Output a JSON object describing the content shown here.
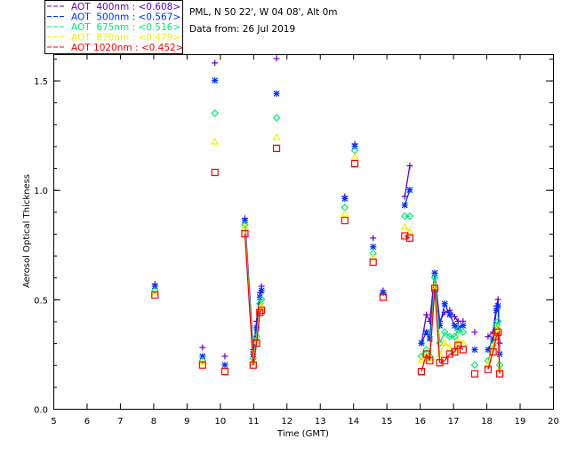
{
  "chart_data": {
    "type": "scatter",
    "title_lines": [
      "PML, N 50 22', W 04 08', Alt 0m",
      "Data from: 26 Jul 2019"
    ],
    "xlabel": "Time (GMT)",
    "ylabel": "Aerosol Optical Thickness",
    "xlim": [
      5,
      20
    ],
    "ylim": [
      0,
      1.62
    ],
    "xticks": [
      "5",
      "6",
      "7",
      "8",
      "9",
      "10",
      "11",
      "12",
      "13",
      "14",
      "15",
      "16",
      "17",
      "18",
      "19",
      "20"
    ],
    "yticks": [
      "0.0",
      "0.5",
      "1.0",
      "1.5"
    ],
    "legend_placement": "top-left",
    "x": [
      8.05,
      9.48,
      9.85,
      10.15,
      10.75,
      11.0,
      11.1,
      11.2,
      11.25,
      11.7,
      13.75,
      14.05,
      14.6,
      14.9,
      15.55,
      15.7,
      16.05,
      16.2,
      16.3,
      16.45,
      16.6,
      16.75,
      16.9,
      17.05,
      17.15,
      17.3,
      17.65,
      18.05,
      18.2,
      18.3,
      18.35,
      18.4
    ],
    "series": [
      {
        "name": "AOT  400nm : <0.608>",
        "color": "#6a00c8",
        "marker": "plus",
        "values": [
          0.57,
          0.28,
          1.58,
          0.24,
          0.87,
          0.27,
          0.4,
          0.53,
          0.56,
          1.6,
          0.97,
          1.21,
          0.78,
          0.54,
          0.97,
          1.11,
          0.3,
          0.43,
          0.4,
          0.62,
          0.4,
          0.44,
          0.45,
          0.42,
          0.4,
          0.4,
          0.35,
          0.33,
          0.35,
          0.47,
          0.5,
          0.3
        ]
      },
      {
        "name": "AOT  500nm : <0.567>",
        "color": "#0030ff",
        "marker": "asterisk",
        "values": [
          0.56,
          0.24,
          1.5,
          0.2,
          0.86,
          0.25,
          0.37,
          0.51,
          0.54,
          1.44,
          0.96,
          1.2,
          0.74,
          0.53,
          0.93,
          1.0,
          0.3,
          0.35,
          0.32,
          0.62,
          0.38,
          0.48,
          0.43,
          0.38,
          0.37,
          0.38,
          0.27,
          0.27,
          0.32,
          0.45,
          0.47,
          0.25
        ]
      },
      {
        "name": "AOT  675nm : <0.516>",
        "color": "#00e878",
        "marker": "diamond",
        "values": [
          0.54,
          0.22,
          1.35,
          null,
          0.84,
          0.23,
          0.33,
          0.48,
          0.5,
          1.33,
          0.92,
          1.18,
          0.71,
          null,
          0.88,
          0.88,
          0.24,
          0.27,
          0.24,
          0.6,
          0.3,
          0.35,
          0.33,
          0.33,
          0.36,
          0.35,
          0.2,
          0.22,
          0.29,
          0.38,
          0.4,
          0.2
        ]
      },
      {
        "name": "AOT  870nm : <0.479>",
        "color": "#f0f000",
        "marker": "triangle",
        "values": [
          0.53,
          0.21,
          1.22,
          null,
          0.83,
          0.21,
          0.31,
          0.46,
          0.47,
          1.24,
          0.89,
          1.15,
          0.69,
          null,
          0.83,
          0.81,
          0.22,
          0.25,
          0.23,
          0.56,
          0.25,
          0.3,
          0.28,
          0.27,
          0.31,
          0.3,
          null,
          0.2,
          0.28,
          0.35,
          0.37,
          0.18
        ]
      },
      {
        "name": "AOT 1020nm : <0.452>",
        "color": "#ff0000",
        "marker": "square",
        "values": [
          0.52,
          0.2,
          1.08,
          0.17,
          0.8,
          0.2,
          0.3,
          0.44,
          0.45,
          1.19,
          0.86,
          1.12,
          0.67,
          0.51,
          0.79,
          0.78,
          0.17,
          0.25,
          0.22,
          0.55,
          0.21,
          0.22,
          0.25,
          0.26,
          0.29,
          0.27,
          0.16,
          0.18,
          0.26,
          0.33,
          0.35,
          0.16
        ]
      }
    ]
  }
}
